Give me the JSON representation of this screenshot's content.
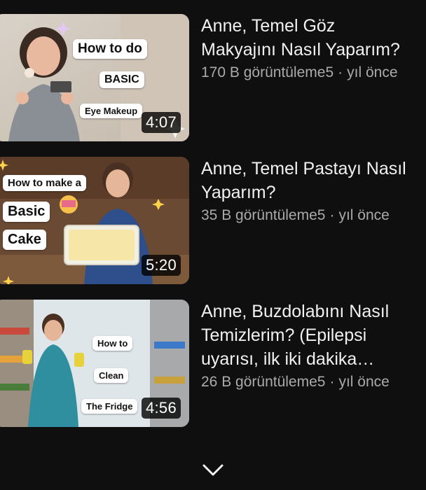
{
  "videos": [
    {
      "title": "Anne, Temel Göz\nMakyajını Nasıl Yaparım?",
      "views": "170 B görüntüleme5",
      "separator": "·",
      "age": "yıl önce",
      "duration": "4:07",
      "thumbnail_text": [
        "How to do",
        "BASIC",
        "Eye Makeup"
      ]
    },
    {
      "title": "Anne, Temel Pastayı Nasıl\nYaparım?",
      "views": "35 B görüntüleme5",
      "separator": "·",
      "age": "yıl önce",
      "duration": "5:20",
      "thumbnail_text": [
        "How to make a",
        "Basic",
        "Cake"
      ]
    },
    {
      "title": "Anne, Buzdolabını Nasıl\nTemizlerim? (Epilepsi\nuyarısı, ilk iki dakika…",
      "views": "26 B görüntüleme5",
      "separator": "·",
      "age": "yıl önce",
      "duration": "4:56",
      "thumbnail_text": [
        "How to",
        "Clean",
        "The Fridge"
      ]
    }
  ],
  "expand_icon": "chevron-down-icon",
  "colors": {
    "background": "#0f0f0f",
    "title": "#f1f1f1",
    "meta": "#aaaaaa"
  }
}
